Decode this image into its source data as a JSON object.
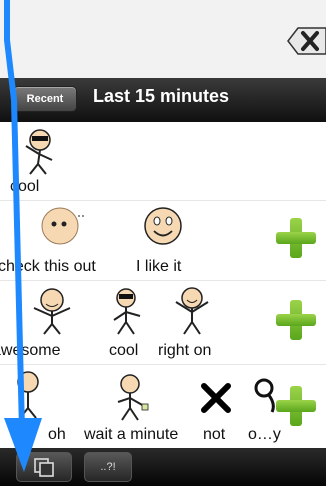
{
  "header": {
    "recent_label": "Recent",
    "title": "Last 15 minutes"
  },
  "rows": [
    {
      "items": [
        "cool"
      ]
    },
    {
      "items": [
        "check this out",
        "I like it"
      ]
    },
    {
      "items": [
        "awesome",
        "cool",
        "right on"
      ]
    },
    {
      "items": [
        "oh",
        "wait a minute",
        "not",
        "o…y"
      ]
    }
  ],
  "toolbar": {
    "punct_label": "..?!"
  },
  "icons": [
    "close-icon",
    "plus-icon",
    "copy-pages-icon"
  ],
  "colors": {
    "header_bg": "#1a1a1a",
    "plus_green": "#6cbf2a",
    "arrow_blue": "#1e88ff",
    "face_fill": "#f6d9b3"
  }
}
